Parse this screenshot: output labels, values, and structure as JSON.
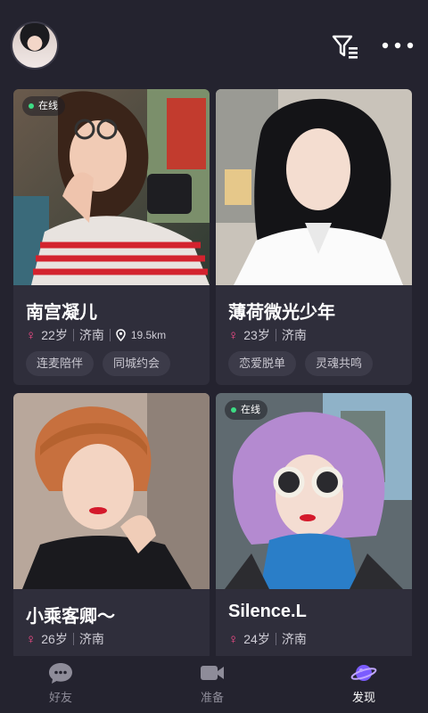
{
  "header": {
    "avatar_icon": "user-avatar",
    "filter_icon": "filter-icon",
    "more_icon": "more-dots-icon"
  },
  "cards": [
    {
      "name": "南宫凝儿",
      "online_label": "在线",
      "age": "22岁",
      "city": "济南",
      "distance": "19.5km",
      "tags": [
        "连麦陪伴",
        "同城约会"
      ]
    },
    {
      "name": "薄荷微光少年",
      "age": "23岁",
      "city": "济南",
      "tags": [
        "恋爱脱单",
        "灵魂共鸣"
      ]
    },
    {
      "name": "小乘客卿～",
      "age": "26岁",
      "city": "济南"
    },
    {
      "name": "Silence.L",
      "online_label": "在线",
      "age": "24岁",
      "city": "济南"
    }
  ],
  "gender_symbol": "♀",
  "tabbar": {
    "items": [
      {
        "label": "好友",
        "icon": "chat-bubble-icon"
      },
      {
        "label": "准备",
        "icon": "video-camera-icon"
      },
      {
        "label": "发现",
        "icon": "planet-icon"
      }
    ],
    "active": "发现"
  },
  "colors": {
    "background": "#24232f",
    "card": "#2f2e3b",
    "female": "#ff4d8d",
    "online": "#3ddc84",
    "accent_planet": "#7b5cff"
  }
}
